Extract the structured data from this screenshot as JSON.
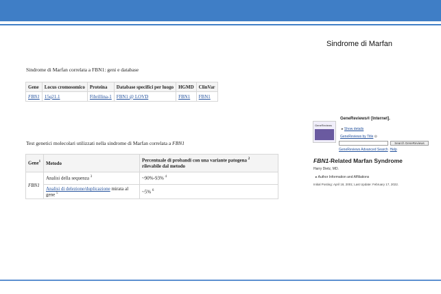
{
  "slide": {
    "title": "Sindrome di Marfan"
  },
  "caption1": "Sindrome di Marfan correlata a FBN1: geni e database",
  "table1": {
    "headers": [
      "Gene",
      "Locus cromosomico",
      "Proteina",
      "Database specifici per luogo",
      "HGMD",
      "ClinVar"
    ],
    "row": [
      "FBN1",
      "15q21.1",
      "Fibrillina-1",
      "FBN1 @ LOVD",
      "FBN1",
      "FBN1"
    ]
  },
  "caption2": {
    "prefix": "Test genetici molecolari utilizzati nella sindrome di Marfan correlata a ",
    "gene": "FBN1"
  },
  "table2": {
    "h_gene": "Gene",
    "h_gene_sup": "1",
    "h_method": "Metodo",
    "h_percent": "Percentuale di probandi con una variante patogena",
    "h_percent_sup": "2",
    "h_percent_2": "rilevabile dal metodo",
    "gene": "FBN1",
    "r1_method": "Analisi della sequenza",
    "r1_method_sup": "3",
    "r1_value": "~90%-93%",
    "r1_value_sup": "4",
    "r2_method_link": "Analisi di delezione/duplicazione",
    "r2_method_rest": "mirata al gene",
    "r2_method_sup": "5",
    "r2_value": "~5%",
    "r2_value_sup": "6"
  },
  "genereviews": {
    "thumb_text": "GeneReviews",
    "heading": "GeneReviews® [Internet].",
    "show_details": "Show details",
    "by_title": "GeneReviews by Title",
    "search_button": "Search GeneReviews",
    "advanced": "GeneReviews Advanced Search",
    "help": "Help",
    "title_gene": "FBN1",
    "title_rest": "-Related Marfan Syndrome",
    "author": "Harry Dietz, MD.",
    "affiliations": "Author Information and Affiliations",
    "dates": "Initial Posting: April 18, 2001; Last Update: February 17, 2022."
  }
}
